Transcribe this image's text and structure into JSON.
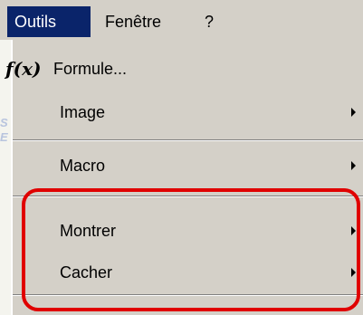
{
  "menubar": {
    "outils_label": "Outils",
    "fenetre_label": "Fenêtre",
    "help_label": "?"
  },
  "dropdown": {
    "items": [
      {
        "label": "Formule...",
        "icon": "function-fx-icon",
        "icon_text": "f(x)",
        "submenu": false
      },
      {
        "label": "Image",
        "submenu": true
      },
      {
        "label": "Macro",
        "submenu": true
      },
      {
        "label": "Montrer",
        "submenu": true
      },
      {
        "label": "Cacher",
        "submenu": true
      }
    ]
  },
  "colors": {
    "menu_bg": "#d4d0c8",
    "active_menu_bg": "#0a246a",
    "highlight_border": "#e00000"
  }
}
